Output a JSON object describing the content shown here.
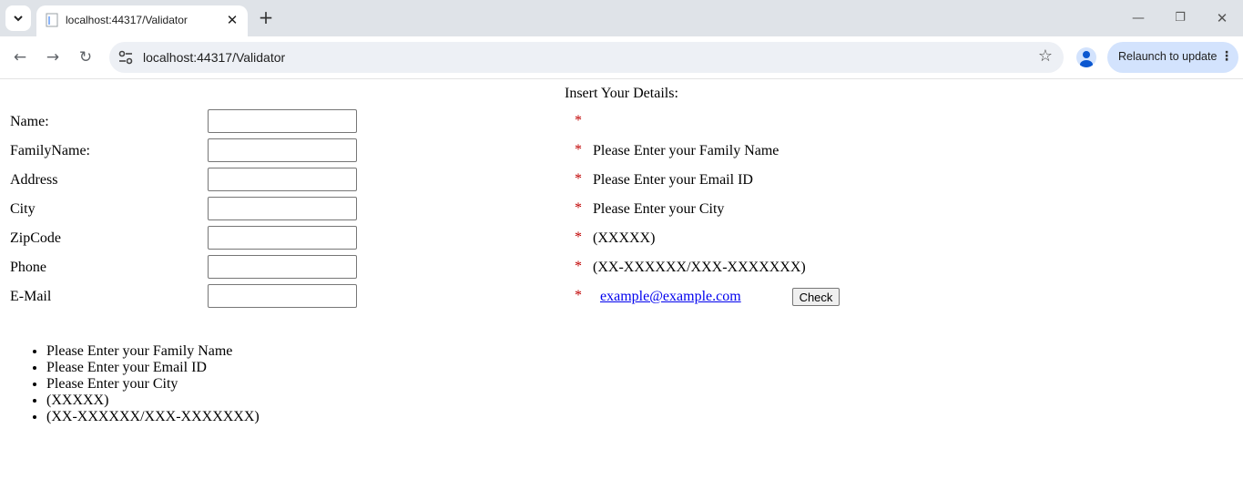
{
  "browser": {
    "tab_title": "localhost:44317/Validator",
    "url": "localhost:44317/Validator",
    "relaunch_label": "Relaunch to update"
  },
  "page": {
    "heading": "Insert Your Details:",
    "fields": [
      {
        "label": "Name:",
        "value": "",
        "required_mark": "*",
        "message": ""
      },
      {
        "label": "FamilyName:",
        "value": "",
        "required_mark": "*",
        "message": "Please Enter your Family Name"
      },
      {
        "label": "Address",
        "value": "",
        "required_mark": "*",
        "message": "Please Enter your Email ID"
      },
      {
        "label": "City",
        "value": "",
        "required_mark": "*",
        "message": "Please Enter your City"
      },
      {
        "label": "ZipCode",
        "value": "",
        "required_mark": "*",
        "message": "(XXXXX)"
      },
      {
        "label": "Phone",
        "value": "",
        "required_mark": "*",
        "message": "(XX-XXXXXX/XXX-XXXXXXX)"
      },
      {
        "label": "E-Mail",
        "value": "",
        "required_mark": "*",
        "message": ""
      }
    ],
    "email_example": "example@example.com",
    "check_button": "Check",
    "summary": [
      "Please Enter your Family Name",
      "Please Enter your Email ID",
      "Please Enter your City",
      "(XXXXX)",
      "(XX-XXXXXX/XXX-XXXXXXX)"
    ]
  }
}
